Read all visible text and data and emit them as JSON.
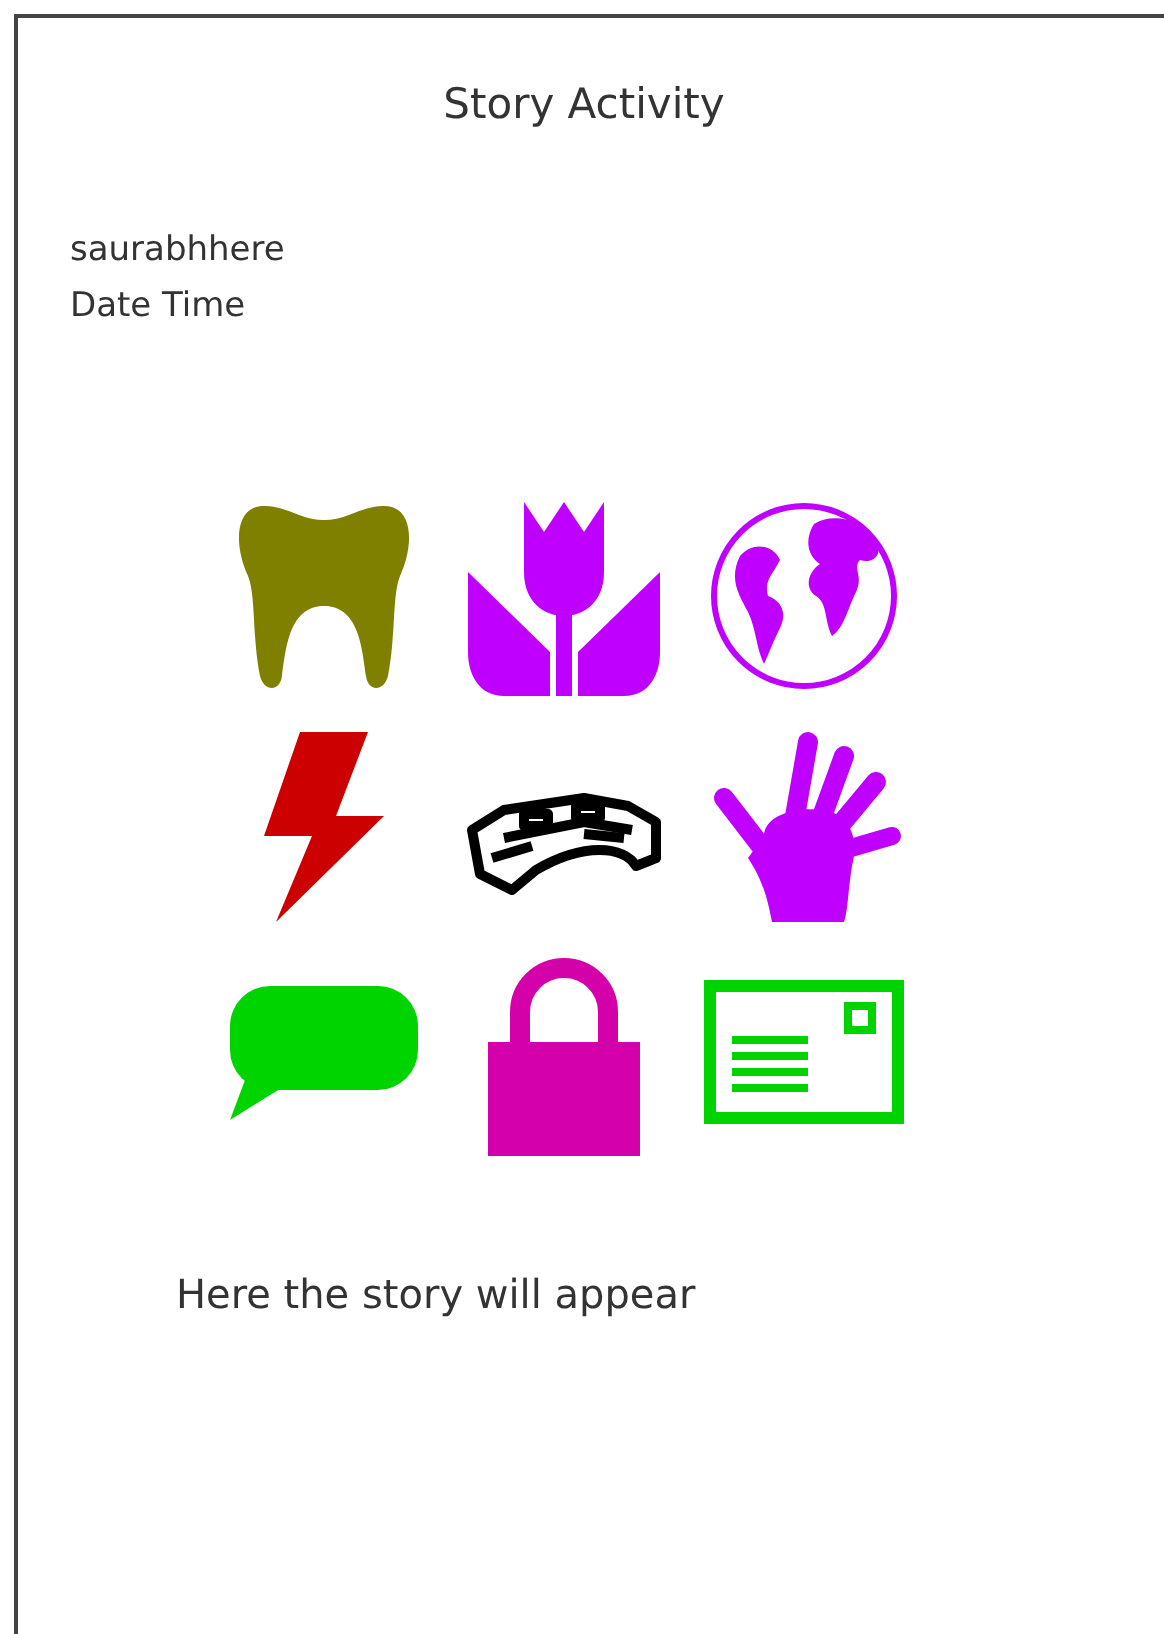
{
  "title": "Story Activity",
  "user": {
    "name": "saurabhhere",
    "datetime": "Date Time"
  },
  "icons": [
    {
      "kind": "tooth",
      "color": "#808000"
    },
    {
      "kind": "tulip",
      "color": "#bf00ff"
    },
    {
      "kind": "globe",
      "color": "#bf00ff"
    },
    {
      "kind": "lightning",
      "color": "#cc0000"
    },
    {
      "kind": "bridge",
      "color": "#000000"
    },
    {
      "kind": "hand",
      "color": "#bf00ff"
    },
    {
      "kind": "speech-bubble",
      "color": "#00d400"
    },
    {
      "kind": "padlock",
      "color": "#d400aa"
    },
    {
      "kind": "postcard",
      "color": "#00d400"
    }
  ],
  "story": "Here the story will appear"
}
